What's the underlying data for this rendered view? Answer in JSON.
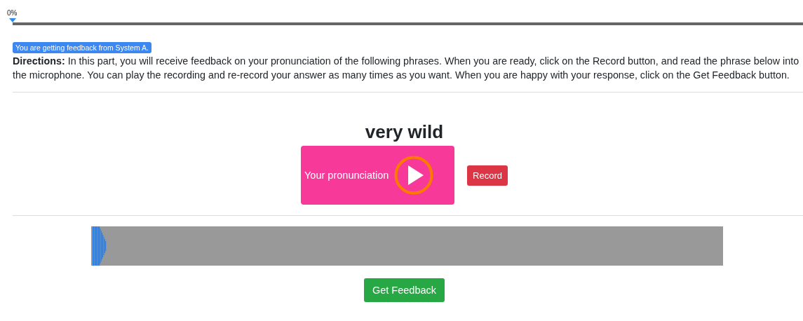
{
  "progress": {
    "label": "0%",
    "level": 0
  },
  "system_badge": "You are getting feedback from System A.",
  "directions": "**Directions:** In this part, you will receive feedback on your pronunciation of the following phrases. When you are ready, click on the Record button, and read the phrase below into the microphone. You can play the recording and re-record your answer as many times as you want. When you are happy with your response, click on the Get Feedback button.",
  "phrase": "very wild",
  "player": {
    "label": "Your pronunciation"
  },
  "record_button": "Record",
  "feedback_button": "Get Feedback"
}
